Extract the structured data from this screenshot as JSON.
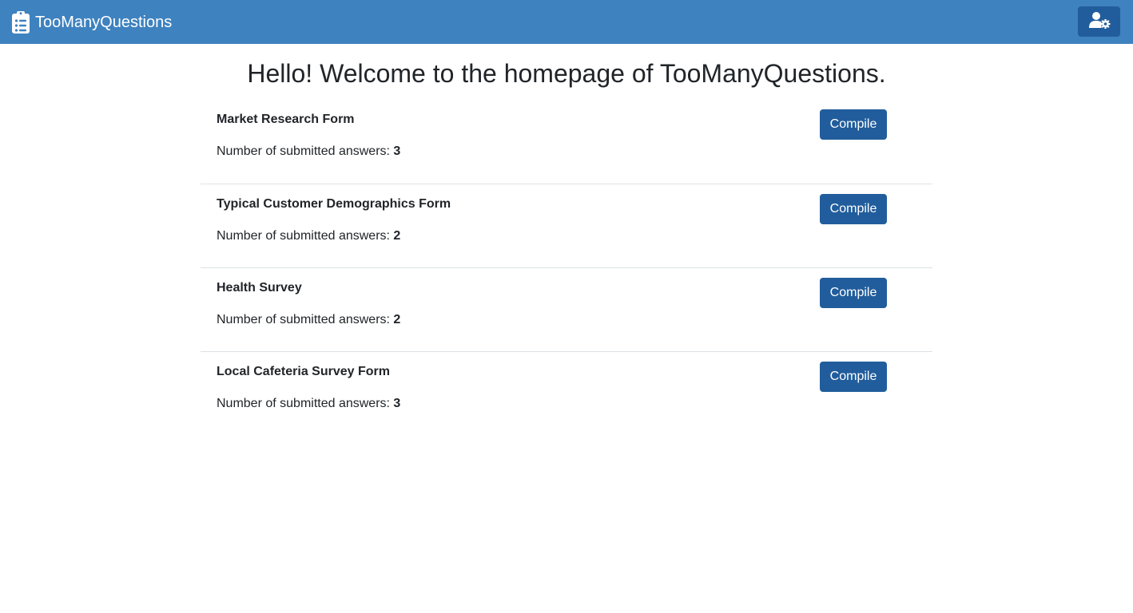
{
  "navbar": {
    "brand": "TooManyQuestions",
    "brand_icon": "clipboard-list-icon",
    "user_settings_icon": "user-cog-icon",
    "bg_color": "#3e82bf"
  },
  "main": {
    "title": "Hello! Welcome to the homepage of TooManyQuestions.",
    "forms": [
      {
        "name": "Market Research Form",
        "count_label": "Number of submitted answers: ",
        "count": "3",
        "button": "Compile"
      },
      {
        "name": "Typical Customer Demographics Form",
        "count_label": "Number of submitted answers: ",
        "count": "2",
        "button": "Compile"
      },
      {
        "name": "Health Survey",
        "count_label": "Number of submitted answers: ",
        "count": "2",
        "button": "Compile"
      },
      {
        "name": "Local Cafeteria Survey Form",
        "count_label": "Number of submitted answers: ",
        "count": "3",
        "button": "Compile"
      }
    ]
  },
  "colors": {
    "button": "#215d9c",
    "divider": "#dee2e6"
  }
}
